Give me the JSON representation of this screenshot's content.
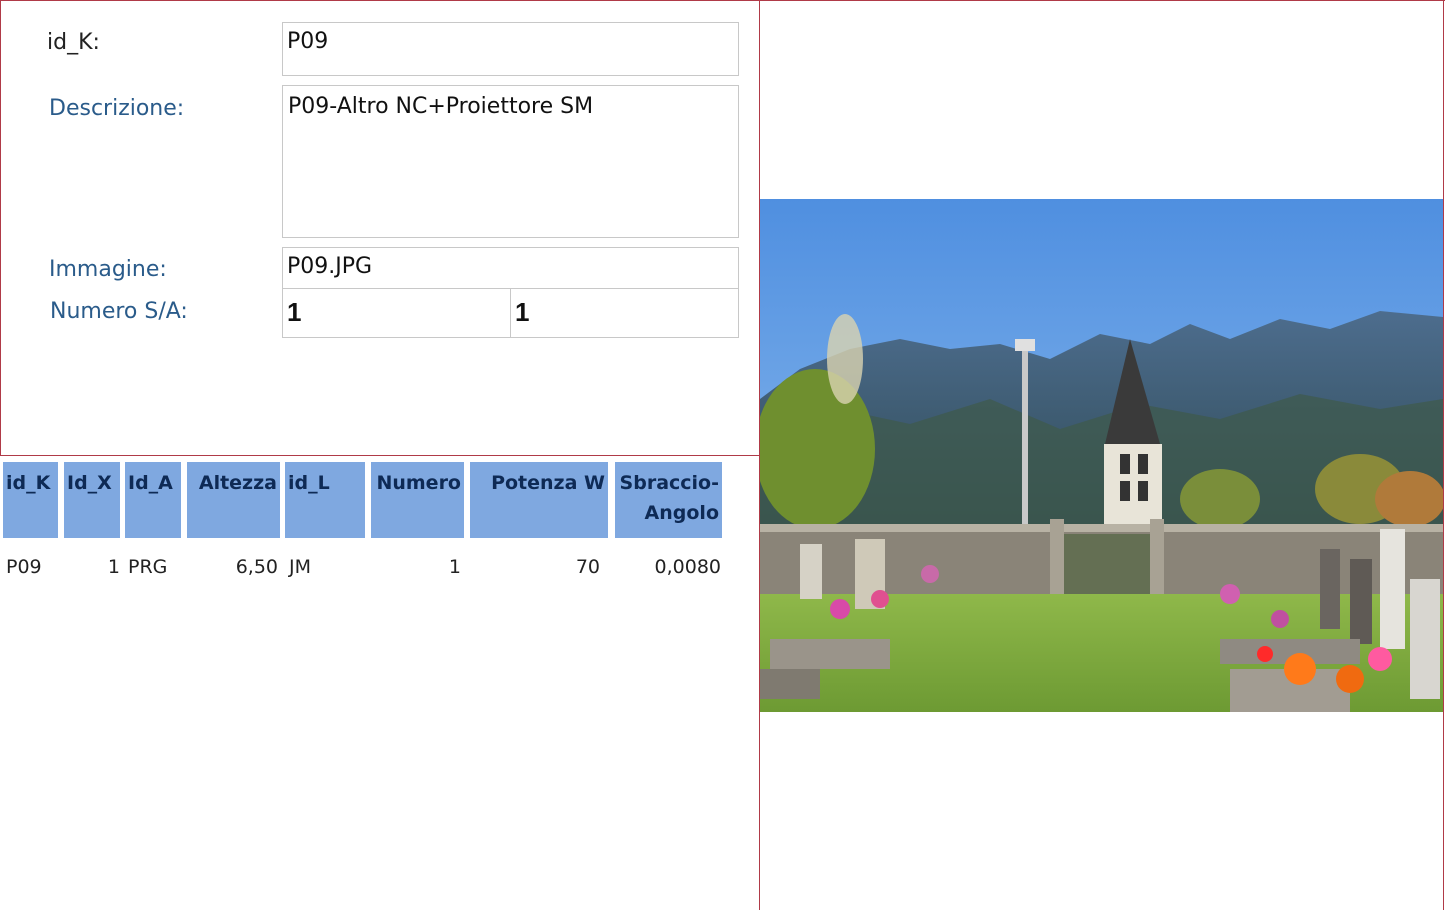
{
  "form": {
    "id_k_label": "id_K:",
    "id_k_value": "P09",
    "descrizione_label": "Descrizione:",
    "descrizione_value": "P09-Altro NC+Proiettore SM",
    "immagine_label": "Immagine:",
    "immagine_value": "P09.JPG",
    "numero_label": "Numero S/A:",
    "numero_s": "1",
    "numero_a": "1"
  },
  "table": {
    "headers": [
      "id_K",
      "Id_X",
      "Id_A",
      "Altezza",
      "id_L",
      "Numero",
      "Potenza W",
      "Sbraccio-Angolo"
    ],
    "header_sbraccio_line1": "Sbraccio-",
    "header_sbraccio_line2": "Angolo",
    "rows": [
      [
        "P09",
        "1",
        "PRG",
        "6,50",
        "JM",
        "1",
        "70",
        "0,0080"
      ]
    ]
  },
  "colors": {
    "border": "#b03a48",
    "header_bg": "#7fa8e0",
    "header_text": "#0e2a55",
    "label_blue": "#2a5b8a"
  },
  "photo": {
    "icon": "photo-church-cemetery-icon"
  }
}
